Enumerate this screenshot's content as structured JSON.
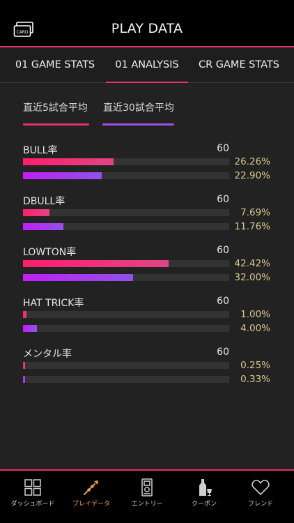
{
  "header": {
    "title": "PLAY DATA",
    "card_label": "CARD"
  },
  "tabs": [
    {
      "label": "01 GAME STATS",
      "active": false
    },
    {
      "label": "01 ANALYSIS",
      "active": true
    },
    {
      "label": "CR GAME STATS",
      "active": false
    }
  ],
  "legend": {
    "recent5": {
      "label": "直近5試合平均",
      "color": "#e4336a"
    },
    "recent30": {
      "label": "直近30試合平均",
      "color": "#a34de9"
    }
  },
  "stats": [
    {
      "label": "BULL率",
      "max": "60",
      "recent5": 26.26,
      "recent30": 22.9,
      "recent5_text": "26.26%",
      "recent30_text": "22.90%"
    },
    {
      "label": "DBULL率",
      "max": "60",
      "recent5": 7.69,
      "recent30": 11.76,
      "recent5_text": "7.69%",
      "recent30_text": "11.76%"
    },
    {
      "label": "LOWTON率",
      "max": "60",
      "recent5": 42.42,
      "recent30": 32.0,
      "recent5_text": "42.42%",
      "recent30_text": "32.00%"
    },
    {
      "label": "HAT TRICK率",
      "max": "60",
      "recent5": 1.0,
      "recent30": 4.0,
      "recent5_text": "1.00%",
      "recent30_text": "4.00%"
    },
    {
      "label": "メンタル率",
      "max": "60",
      "recent5": 0.25,
      "recent30": 0.33,
      "recent5_text": "0.25%",
      "recent30_text": "0.33%"
    }
  ],
  "bottom_nav": [
    {
      "label": "ダッシュボード",
      "icon": "dashboard-grid-icon",
      "active": false
    },
    {
      "label": "プレイデータ",
      "icon": "dart-icon",
      "active": true
    },
    {
      "label": "エントリー",
      "icon": "dart-machine-icon",
      "active": false
    },
    {
      "label": "クーポン",
      "icon": "bottle-glass-icon",
      "active": false
    },
    {
      "label": "フレンド",
      "icon": "heart-icon",
      "active": false
    }
  ],
  "colors": {
    "accent": "#e4336a",
    "purple": "#a34de9",
    "percent_text": "#d6c98c",
    "active_nav": "#f0a23b"
  }
}
